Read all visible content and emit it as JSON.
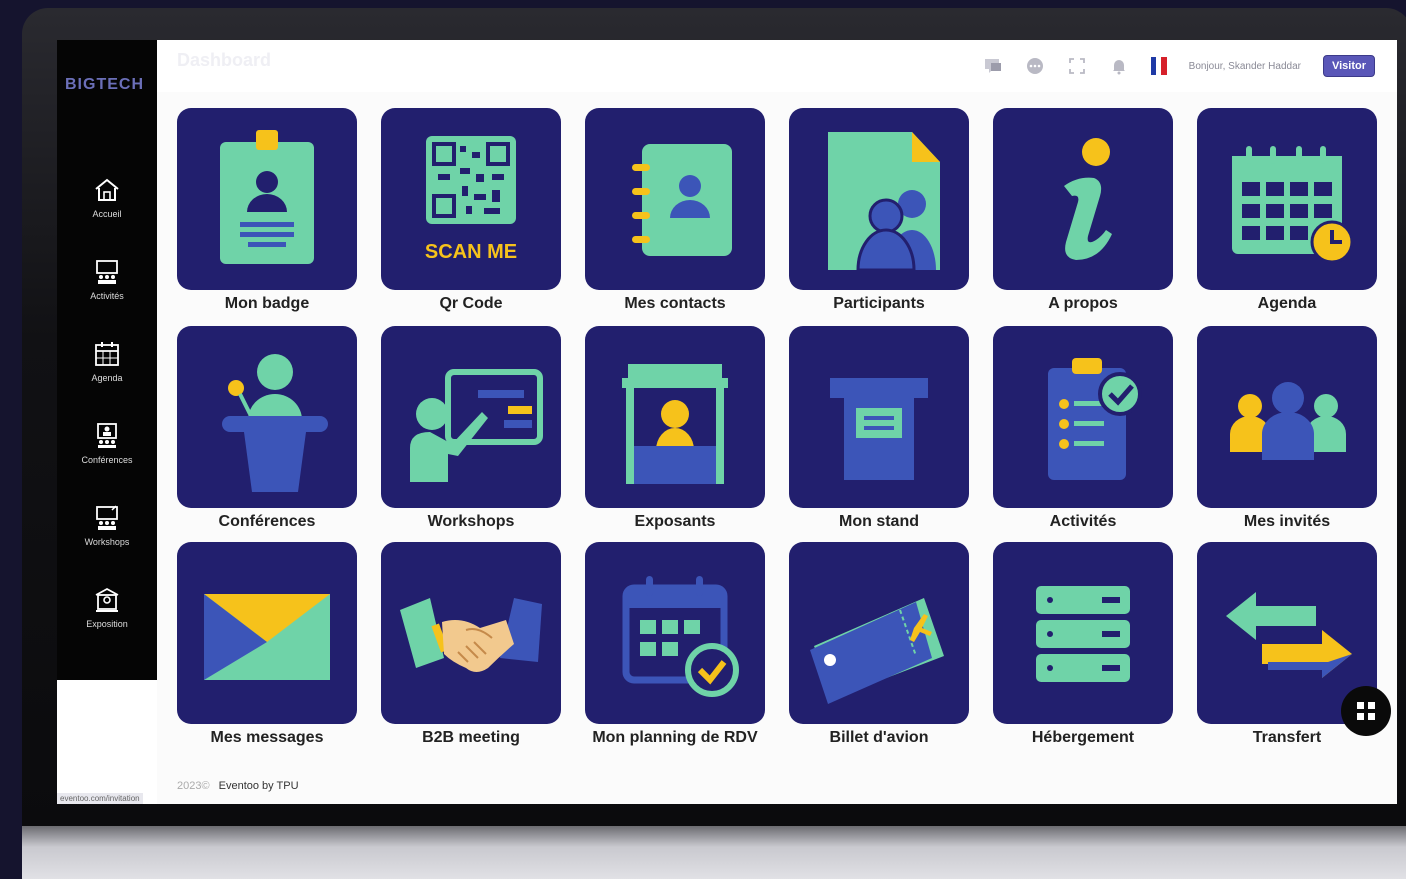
{
  "brand": "BIGTECH",
  "header": {
    "title": "Dashboard",
    "greeting": "Bonjour, Skander Haddar",
    "role_badge": "Visitor",
    "flag_colors": [
      "#1f3aa6",
      "#ffffff",
      "#d6202a"
    ]
  },
  "sidebar": {
    "items": [
      {
        "label": "Accueil",
        "icon": "home-icon"
      },
      {
        "label": "Activités",
        "icon": "presentation-icon"
      },
      {
        "label": "Agenda",
        "icon": "calendar-icon"
      },
      {
        "label": "Conférences",
        "icon": "conference-icon"
      },
      {
        "label": "Workshops",
        "icon": "workshop-icon"
      },
      {
        "label": "Exposition",
        "icon": "exposition-icon"
      }
    ]
  },
  "tiles": [
    {
      "label": "Mon badge",
      "icon": "badge-icon"
    },
    {
      "label": "Qr Code",
      "icon": "qr-code-icon",
      "caption": "SCAN ME"
    },
    {
      "label": "Mes contacts",
      "icon": "contacts-icon"
    },
    {
      "label": "Participants",
      "icon": "participants-icon"
    },
    {
      "label": "A propos",
      "icon": "info-icon"
    },
    {
      "label": "Agenda",
      "icon": "agenda-icon"
    },
    {
      "label": "Conférences",
      "icon": "podium-icon"
    },
    {
      "label": "Workshops",
      "icon": "whiteboard-icon"
    },
    {
      "label": "Exposants",
      "icon": "exhibitor-booth-icon"
    },
    {
      "label": "Mon stand",
      "icon": "stand-icon"
    },
    {
      "label": "Activités",
      "icon": "checklist-icon"
    },
    {
      "label": "Mes invités",
      "icon": "guests-icon"
    },
    {
      "label": "Mes messages",
      "icon": "envelope-icon"
    },
    {
      "label": "B2B meeting",
      "icon": "handshake-icon"
    },
    {
      "label": "Mon planning de RDV",
      "icon": "planning-icon"
    },
    {
      "label": "Billet d'avion",
      "icon": "plane-ticket-icon"
    },
    {
      "label": "Hébergement",
      "icon": "hosting-icon"
    },
    {
      "label": "Transfert",
      "icon": "transfer-icon"
    }
  ],
  "footer": {
    "year": "2023©",
    "credit": "Eventoo by TPU"
  },
  "status_url": "eventoo.com/invitation",
  "colors": {
    "tile_bg": "#221f6e",
    "mint": "#6fd3a8",
    "yellow": "#f6c21b",
    "blue": "#3c55b8"
  }
}
